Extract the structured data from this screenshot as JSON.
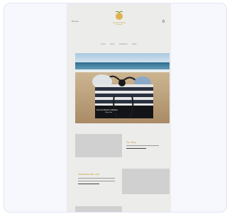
{
  "header": {
    "left_label": "Browse",
    "brand_name": "COCO BAG",
    "brand_tagline": "Handmade",
    "icons": {
      "cart": "cart-icon",
      "logo": "coconut-logo"
    }
  },
  "nav": {
    "items": [
      "Home",
      "Shop",
      "Collections",
      "About"
    ]
  },
  "hero": {
    "caption": "Summer Beach Collection",
    "sub": "Shop Now"
  },
  "sections": {
    "first_title": "Our Story",
    "second_title": "Handmade with Love"
  },
  "colors": {
    "accent": "#c9a24a",
    "page_bg": "#ececea",
    "placeholder": "#d0d0d0",
    "card_bg": "#f6f8fd"
  }
}
